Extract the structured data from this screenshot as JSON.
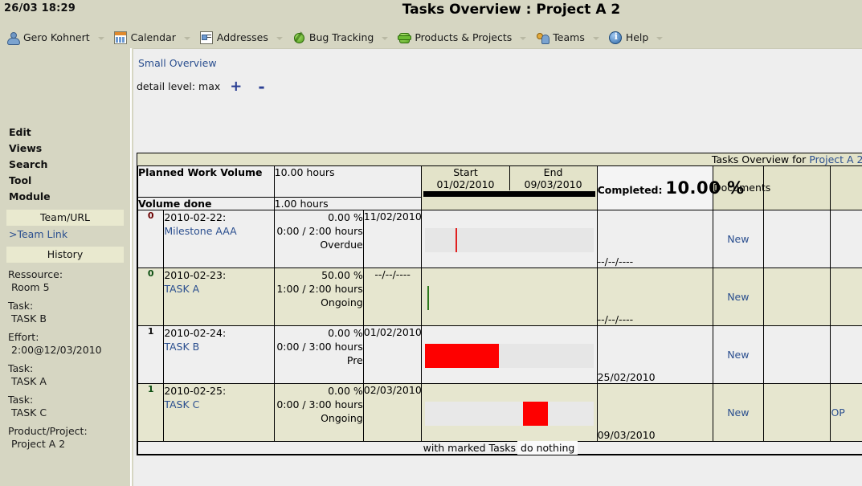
{
  "topbar": {
    "clock": "26/03 18:29",
    "title": "Tasks Overview : Project A 2"
  },
  "menu": {
    "items": [
      {
        "label": "Gero Kohnert",
        "icon": "user-icon"
      },
      {
        "label": "Calendar",
        "icon": "calendar-icon"
      },
      {
        "label": "Addresses",
        "icon": "addressbook-icon"
      },
      {
        "label": "Bug Tracking",
        "icon": "bug-icon"
      },
      {
        "label": "Products & Projects",
        "icon": "puzzle-icon"
      },
      {
        "label": "Teams",
        "icon": "team-icon"
      },
      {
        "label": "Help",
        "icon": "info-icon"
      }
    ]
  },
  "sidebar": {
    "menu": [
      "Edit",
      "Views",
      "Search",
      "Tool",
      "Module"
    ],
    "team_band": "Team/URL",
    "team_link": ">Team Link",
    "history_band": "History",
    "info": [
      {
        "key": "Ressource:",
        "value": "Room 5"
      },
      {
        "key": "Task:",
        "value": "TASK B"
      },
      {
        "key": "Effort:",
        "value": "2:00@12/03/2010"
      },
      {
        "key": "Task:",
        "value": "TASK A"
      },
      {
        "key": "Task:",
        "value": "TASK C"
      },
      {
        "key": "Product/Project:",
        "value": "Project A 2"
      }
    ]
  },
  "content": {
    "breadcrumb": "Small Overview",
    "detail_label": "detail level: max",
    "plus": "+",
    "minus": "-"
  },
  "table": {
    "banner_prefix": "Tasks Overview for ",
    "banner_project": "Project A 2",
    "planned_label": "Planned Work Volume",
    "planned_value": "10.00 hours",
    "done_label": "Volume done",
    "done_value": "1.00 hours",
    "start_label": "Start",
    "start_value": "01/02/2010",
    "end_label": "End",
    "end_value": "09/03/2010",
    "completed_label": "Completed:",
    "completed_value": "10.00 %",
    "documents_label": "Documents",
    "new_label": "New",
    "open_label": "OP",
    "footer_text": "with marked Tasks",
    "footer_action": "do nothing",
    "rows": [
      {
        "flag": "0",
        "flag_style": "red",
        "date": "2010-02-22:",
        "name": "Milestone AAA",
        "percent": "0.00 %",
        "hours": "0:00 / 2:00 hours",
        "status": "Overdue",
        "due": "11/02/2010",
        "end": "--/--/----",
        "bar": {
          "kind": "marker",
          "left_pct": 18,
          "color": "#e02020"
        },
        "action": "New",
        "op": ""
      },
      {
        "flag": "0",
        "flag_style": "green",
        "date": "2010-02-23:",
        "name": "TASK A",
        "percent": "50.00 %",
        "hours": "1:00 / 2:00 hours",
        "status": "Ongoing",
        "due": "--/--/----",
        "end": "--/--/----",
        "bar": {
          "kind": "marker",
          "left_pct": 1,
          "color": "#2f7a1e"
        },
        "action": "New",
        "op": ""
      },
      {
        "flag": "1",
        "flag_style": "none",
        "date": "2010-02-24:",
        "name": "TASK B",
        "percent": "0.00 %",
        "hours": "0:00 / 3:00 hours",
        "status": "Pre",
        "due": "01/02/2010",
        "end": "25/02/2010",
        "bar": {
          "kind": "fill",
          "left_pct": 0,
          "width_pct": 44,
          "color": "#fe0000"
        },
        "action": "New",
        "op": ""
      },
      {
        "flag": "1",
        "flag_style": "green",
        "date": "2010-02-25:",
        "name": "TASK C",
        "percent": "0.00 %",
        "hours": "0:00 / 3:00 hours",
        "status": "Ongoing",
        "due": "02/03/2010",
        "end": "09/03/2010",
        "bar": {
          "kind": "fill",
          "left_pct": 58,
          "width_pct": 15,
          "color": "#fe0000"
        },
        "action": "New",
        "op": "OP"
      }
    ]
  }
}
